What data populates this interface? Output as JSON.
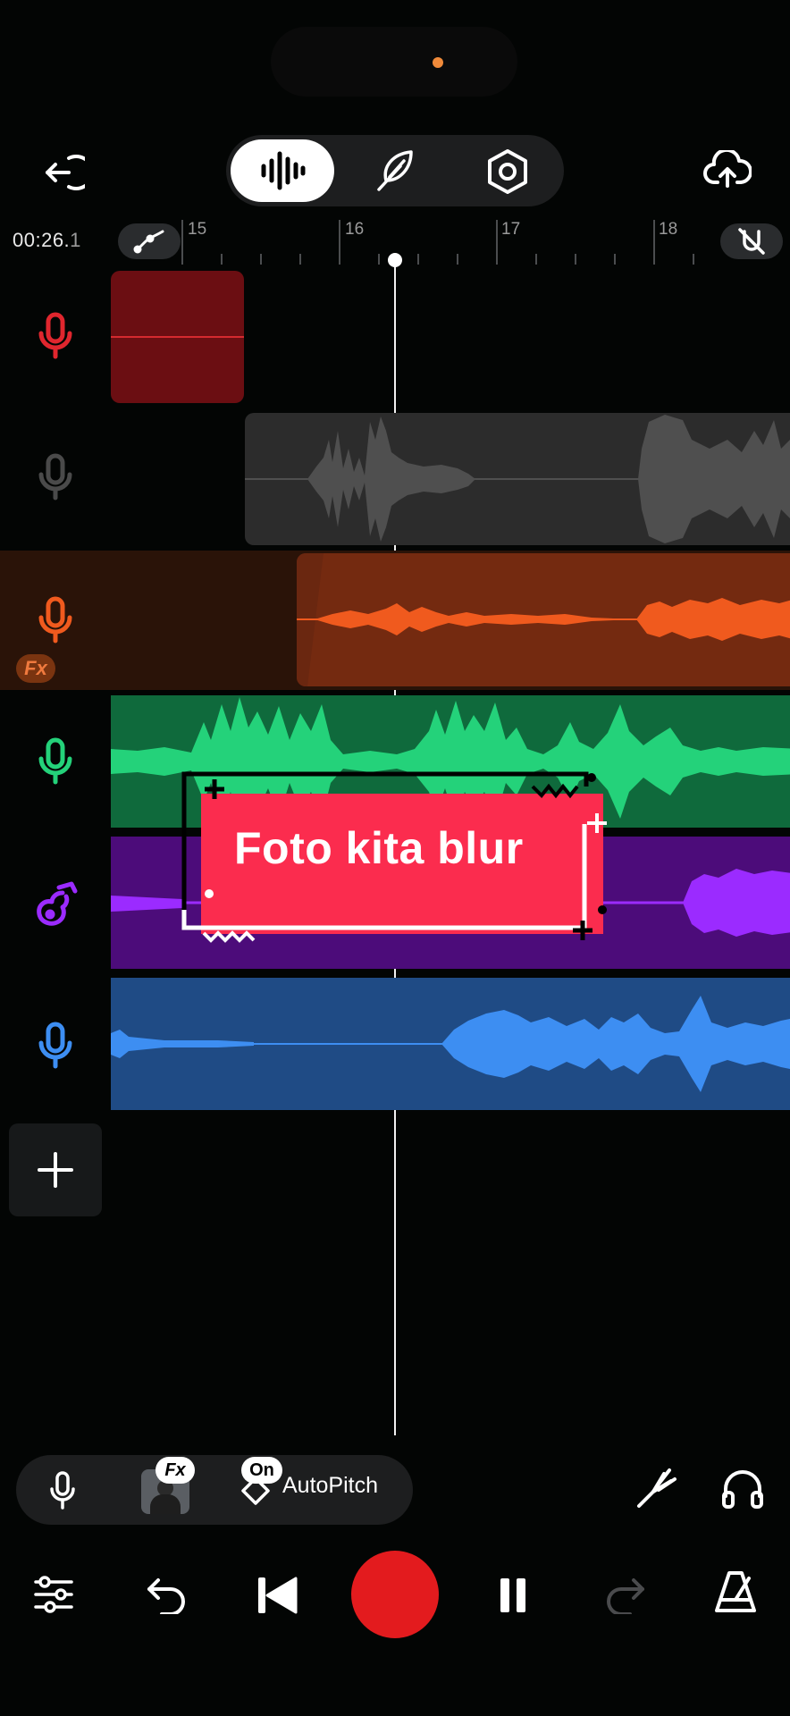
{
  "header": {
    "back_icon": "exit-arrow-icon",
    "modes": [
      {
        "name": "tracks",
        "icon": "waveform-icon",
        "active": true
      },
      {
        "name": "edit",
        "icon": "feather-icon",
        "active": false
      },
      {
        "name": "settings",
        "icon": "hexagon-nut-icon",
        "active": false
      }
    ],
    "upload_icon": "cloud-upload-icon"
  },
  "timeline": {
    "time_main": "00:26.",
    "time_decimal": "1",
    "bar_labels": [
      "15",
      "16",
      "17",
      "18"
    ],
    "automation_icon": "automation-curve-icon",
    "snap_icon": "magnet-off-icon"
  },
  "tracks": [
    {
      "name": "track-1",
      "type": "vocal",
      "color": "#e0262e",
      "clip_color": "#6b0e12"
    },
    {
      "name": "track-2",
      "type": "vocal",
      "color": "#4a4a4a",
      "clip_color": "#2c2c2c"
    },
    {
      "name": "track-3",
      "type": "vocal",
      "color": "#f05a1e",
      "clip_color": "#742a10",
      "fx": "Fx"
    },
    {
      "name": "track-4",
      "type": "vocal",
      "color": "#24d27a",
      "clip_color": "#0f6a3c"
    },
    {
      "name": "track-5",
      "type": "guitar",
      "color": "#9b2bff",
      "clip_color": "#4c0c7a"
    },
    {
      "name": "track-6",
      "type": "vocal",
      "color": "#3d8ef2",
      "clip_color": "#1f4b85"
    }
  ],
  "overlay": {
    "text": "Foto kita blur"
  },
  "input_bar": {
    "mic_icon": "microphone-icon",
    "fx_badge": "Fx",
    "on_badge": "On",
    "autopitch_label": "AutoPitch",
    "tuning_icon": "tuning-fork-icon",
    "headphones_icon": "headphones-icon"
  },
  "transport": {
    "mixer_icon": "sliders-icon",
    "undo_icon": "undo-icon",
    "rewind_icon": "skip-back-icon",
    "record_color": "#e31b1e",
    "pause_icon": "pause-icon",
    "redo_icon": "redo-icon",
    "metronome_icon": "metronome-icon"
  }
}
